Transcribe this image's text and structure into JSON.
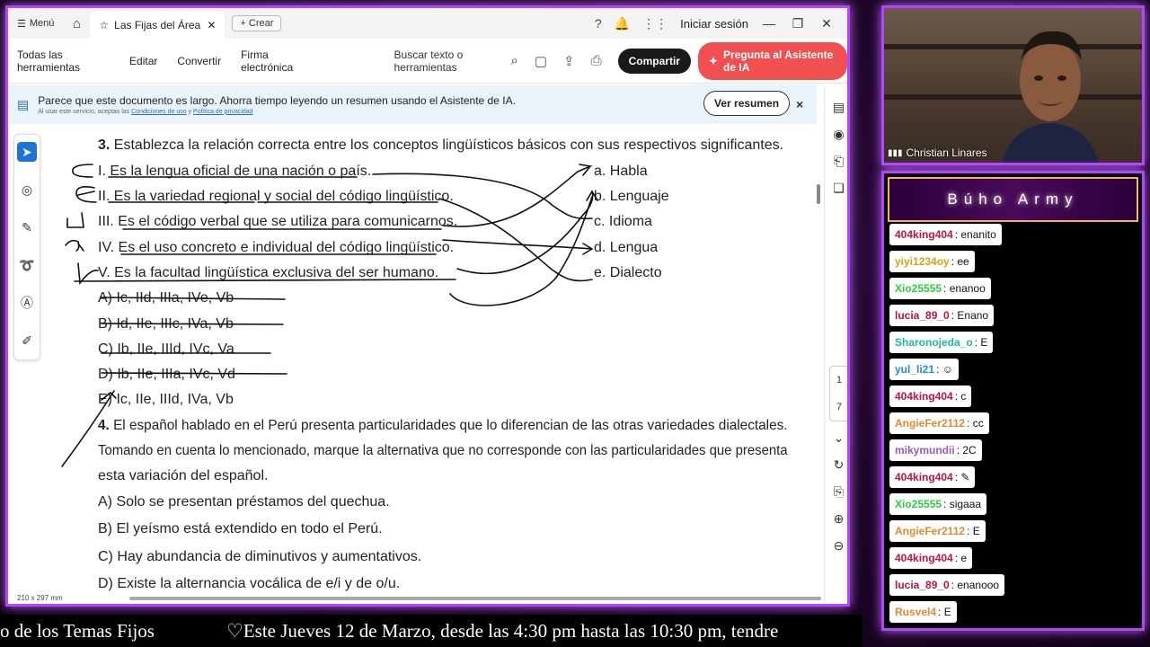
{
  "tabbar": {
    "menu_label": "Menú",
    "tab_title": "Las Fijas del Área A ...",
    "new_tab_label": "Crear",
    "signin_label": "Iniciar sesión"
  },
  "menubar": {
    "items": [
      "Todas las herramientas",
      "Editar",
      "Convertir",
      "Firma electrónica"
    ],
    "search_label": "Buscar texto o herramientas",
    "share_label": "Compartir",
    "ai_label": "Pregunta al Asistente de IA"
  },
  "banner": {
    "text": "Parece que este documento es largo. Ahorra tiempo leyendo un resumen usando el Asistente de IA.",
    "small_prefix": "Al usar este servicio, aceptas las",
    "small_link1": "Condiciones de uso",
    "small_mid": "y",
    "small_link2": "Política de privacidad",
    "button_label": "Ver resumen",
    "close_label": "×"
  },
  "page_nav": {
    "current": "1",
    "total": "7"
  },
  "page_size": "210 x 297 mm",
  "document": {
    "q3_num": "3.",
    "q3_text": "Establezca la relación correcta entre los conceptos lingüísticos básicos con sus respectivos significantes.",
    "q3_items": [
      "I. Es la lengua oficial de una nación o país.",
      "II. Es la variedad regional y social del código lingüístico.",
      "III. Es el código verbal que se utiliza para comunicarnos.",
      "IV. Es el uso concreto e individual del código lingüístico.",
      "V. Es la facultad lingüística exclusiva del ser humano."
    ],
    "q3_targets": [
      "a. Habla",
      "b. Lenguaje",
      "c. Idioma",
      "d. Lengua",
      "e. Dialecto"
    ],
    "q3_options": [
      "A) Ic, IId, IIIa, IVe, Vb",
      "B) Id, IIe, IIIc, IVa, Vb",
      "C) Ib, IIe, IIId, IVc, Va",
      "D) Ib, IIe, IIIa, IVc, Vd",
      "E) Ic, IIe, IIId, IVa, Vb"
    ],
    "q4_num": "4.",
    "q4_line1": "El español hablado en el Perú presenta particularidades que lo diferencian de las otras variedades dialectales.",
    "q4_line2": "Tomando en cuenta lo mencionado, marque la alternativa que no corresponde con las particularidades que presenta",
    "q4_line3": "esta variación del español.",
    "q4_options": [
      "A) Solo se presentan préstamos del quechua.",
      "B) El yeísmo está extendido en todo el Perú.",
      "C) Hay abundancia de diminutivos y aumentativos.",
      "D) Existe la alternancia vocálica de e/i y de o/u."
    ]
  },
  "cam": {
    "name": "Christian Linares"
  },
  "chat": {
    "title": "Búho Army",
    "messages": [
      {
        "user": "404king404",
        "text": ": enanito",
        "color": "#c0143c"
      },
      {
        "user": "yiyi1234oy",
        "text": ": ee",
        "color": "#d4a017"
      },
      {
        "user": "Xio25555",
        "text": ": enanoo",
        "color": "#2ecc40"
      },
      {
        "user": "lucia_89_0",
        "text": ": Enano",
        "color": "#c0143c"
      },
      {
        "user": "Sharonojeda_o",
        "text": ": E",
        "color": "#1abc9c"
      },
      {
        "user": "yul_li21",
        "text": ": ☺",
        "color": "#1e8fd8"
      },
      {
        "user": "404king404",
        "text": ": c",
        "color": "#c0143c"
      },
      {
        "user": "AngieFer2112",
        "text": ": cc",
        "color": "#e08a2e"
      },
      {
        "user": "mikymundii",
        "text": ": 2C",
        "color": "#9b59b6"
      },
      {
        "user": "404king404",
        "text": ": ✎",
        "color": "#c0143c"
      },
      {
        "user": "Xio25555",
        "text": ": sigaaa",
        "color": "#2ecc40"
      },
      {
        "user": "AngieFer2112",
        "text": ": E",
        "color": "#e08a2e"
      },
      {
        "user": "404king404",
        "text": ": e",
        "color": "#c0143c"
      },
      {
        "user": "lucia_89_0",
        "text": ": enanooo",
        "color": "#c0143c"
      },
      {
        "user": "Rusvel4",
        "text": ": E",
        "color": "#e08a2e"
      }
    ]
  },
  "ticker": {
    "left": "o de los Temas Fijos",
    "right": "♡Este Jueves 12 de Marzo, desde las 4:30 pm hasta las 10:30 pm, tendre"
  },
  "colors": {
    "accent_purple": "#b445ff",
    "ai_button": "#f05050",
    "tool_active": "#1f73d8"
  }
}
